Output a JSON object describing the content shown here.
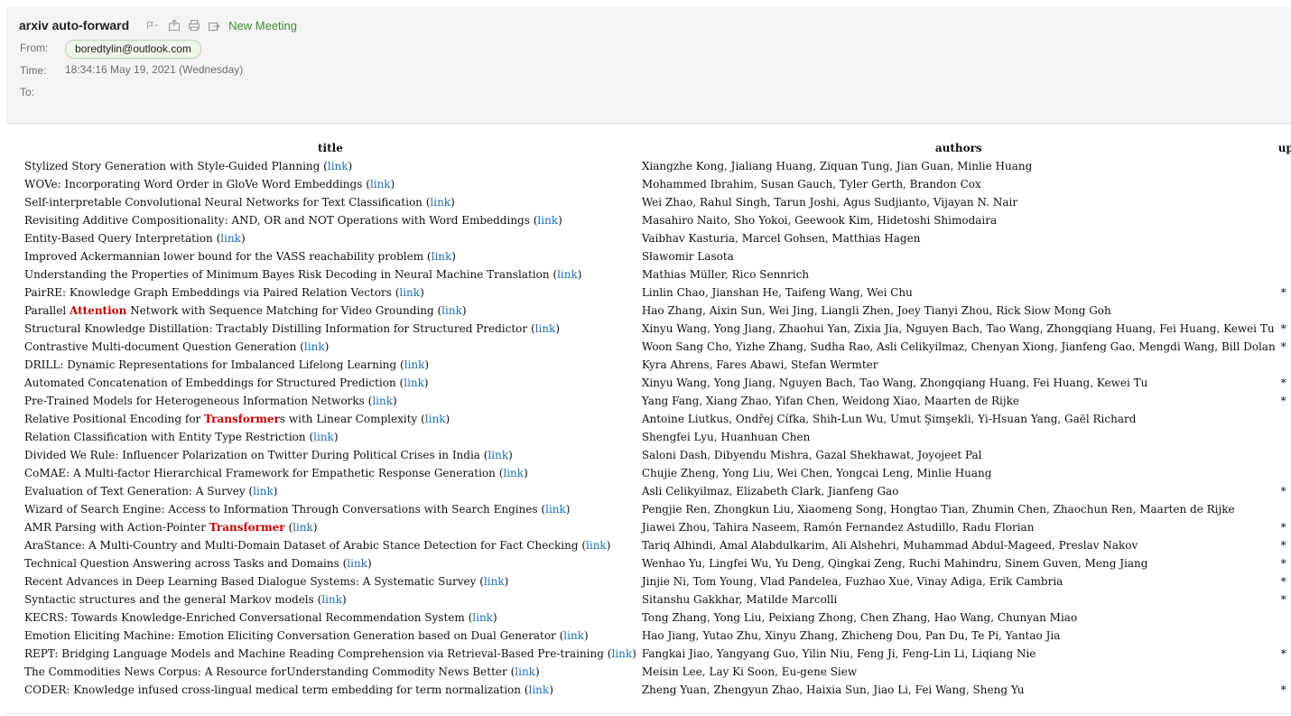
{
  "email": {
    "subject": "arxiv auto-forward",
    "toolbar": {
      "new_meeting_label": "New Meeting"
    },
    "from_label": "From:",
    "from_value": "boredtylin@outlook.com",
    "time_label": "Time:",
    "time_value": "18:34:16 May 19, 2021 (Wednesday)",
    "to_label": "To:"
  },
  "table": {
    "headers": {
      "title": "title",
      "authors": "authors",
      "update": "update"
    },
    "link_text": "link",
    "rows": [
      {
        "parts": [
          {
            "t": "Stylized Story Generation with Style-Guided Planning "
          }
        ],
        "authors": "Xiangzhe Kong, Jialiang Huang, Ziquan Tung, Jian Guan, Minlie Huang",
        "update": ""
      },
      {
        "parts": [
          {
            "t": "WOVe: Incorporating Word Order in GloVe Word Embeddings "
          }
        ],
        "authors": "Mohammed Ibrahim, Susan Gauch, Tyler Gerth, Brandon Cox",
        "update": ""
      },
      {
        "parts": [
          {
            "t": "Self-interpretable Convolutional Neural Networks for Text Classification "
          }
        ],
        "authors": "Wei Zhao, Rahul Singh, Tarun Joshi, Agus Sudjianto, Vijayan N. Nair",
        "update": ""
      },
      {
        "parts": [
          {
            "t": "Revisiting Additive Compositionality: AND, OR and NOT Operations with Word Embeddings "
          }
        ],
        "authors": "Masahiro Naito, Sho Yokoi, Geewook Kim, Hidetoshi Shimodaira",
        "update": ""
      },
      {
        "parts": [
          {
            "t": "Entity-Based Query Interpretation "
          }
        ],
        "authors": "Vaibhav Kasturia, Marcel Gohsen, Matthias Hagen",
        "update": ""
      },
      {
        "parts": [
          {
            "t": "Improved Ackermannian lower bound for the VASS reachability problem "
          }
        ],
        "authors": "Sławomir Lasota",
        "update": ""
      },
      {
        "parts": [
          {
            "t": "Understanding the Properties of Minimum Bayes Risk Decoding in Neural Machine Translation "
          }
        ],
        "authors": "Mathias Müller, Rico Sennrich",
        "update": ""
      },
      {
        "parts": [
          {
            "t": "PairRE: Knowledge Graph Embeddings via Paired Relation Vectors "
          }
        ],
        "authors": "Linlin Chao, Jianshan He, Taifeng Wang, Wei Chu",
        "update": "*"
      },
      {
        "parts": [
          {
            "t": "Parallel "
          },
          {
            "t": "Attention",
            "h": true
          },
          {
            "t": " Network with Sequence Matching for Video Grounding "
          }
        ],
        "authors": "Hao Zhang, Aixin Sun, Wei Jing, Liangli Zhen, Joey Tianyi Zhou, Rick Siow Mong Goh",
        "update": ""
      },
      {
        "parts": [
          {
            "t": "Structural Knowledge Distillation: Tractably Distilling Information for Structured Predictor "
          }
        ],
        "authors": "Xinyu Wang, Yong Jiang, Zhaohui Yan, Zixia Jia, Nguyen Bach, Tao Wang, Zhongqiang Huang, Fei Huang, Kewei Tu",
        "update": "*"
      },
      {
        "parts": [
          {
            "t": "Contrastive Multi-document Question Generation "
          }
        ],
        "authors": "Woon Sang Cho, Yizhe Zhang, Sudha Rao, Asli Celikyilmaz, Chenyan Xiong, Jianfeng Gao, Mengdi Wang, Bill Dolan",
        "update": "*"
      },
      {
        "parts": [
          {
            "t": "DRILL: Dynamic Representations for Imbalanced Lifelong Learning "
          }
        ],
        "authors": "Kyra Ahrens, Fares Abawi, Stefan Wermter",
        "update": ""
      },
      {
        "parts": [
          {
            "t": "Automated Concatenation of Embeddings for Structured Prediction "
          }
        ],
        "authors": "Xinyu Wang, Yong Jiang, Nguyen Bach, Tao Wang, Zhongqiang Huang, Fei Huang, Kewei Tu",
        "update": "*"
      },
      {
        "parts": [
          {
            "t": "Pre-Trained Models for Heterogeneous Information Networks "
          }
        ],
        "authors": "Yang Fang, Xiang Zhao, Yifan Chen, Weidong Xiao, Maarten de Rijke",
        "update": "*"
      },
      {
        "parts": [
          {
            "t": "Relative Positional Encoding for "
          },
          {
            "t": "Transformer",
            "h": true
          },
          {
            "t": "s with Linear Complexity "
          }
        ],
        "authors": "Antoine Liutkus, Ondřej Cífka, Shih-Lun Wu, Umut Şimşekli, Yi-Hsuan Yang, Gaël Richard",
        "update": ""
      },
      {
        "parts": [
          {
            "t": "Relation Classification with Entity Type Restriction "
          }
        ],
        "authors": "Shengfei Lyu, Huanhuan Chen",
        "update": ""
      },
      {
        "parts": [
          {
            "t": "Divided We Rule: Influencer Polarization on Twitter During Political Crises in India "
          }
        ],
        "authors": "Saloni Dash, Dibyendu Mishra, Gazal Shekhawat, Joyojeet Pal",
        "update": ""
      },
      {
        "parts": [
          {
            "t": "CoMAE: A Multi-factor Hierarchical Framework for Empathetic Response Generation "
          }
        ],
        "authors": "Chujie Zheng, Yong Liu, Wei Chen, Yongcai Leng, Minlie Huang",
        "update": ""
      },
      {
        "parts": [
          {
            "t": "Evaluation of Text Generation: A Survey "
          }
        ],
        "authors": "Asli Celikyilmaz, Elizabeth Clark, Jianfeng Gao",
        "update": "*"
      },
      {
        "parts": [
          {
            "t": "Wizard of Search Engine: Access to Information Through Conversations with Search Engines "
          }
        ],
        "authors": "Pengjie Ren, Zhongkun Liu, Xiaomeng Song, Hongtao Tian, Zhumin Chen, Zhaochun Ren, Maarten de Rijke",
        "update": ""
      },
      {
        "parts": [
          {
            "t": "AMR Parsing with Action-Pointer "
          },
          {
            "t": "Transformer",
            "h": true
          },
          {
            "t": " "
          }
        ],
        "authors": "Jiawei Zhou, Tahira Naseem, Ramón Fernandez Astudillo, Radu Florian",
        "update": "*"
      },
      {
        "parts": [
          {
            "t": "AraStance: A Multi-Country and Multi-Domain Dataset of Arabic Stance Detection for Fact Checking "
          }
        ],
        "authors": "Tariq Alhindi, Amal Alabdulkarim, Ali Alshehri, Muhammad Abdul-Mageed, Preslav Nakov",
        "update": "*"
      },
      {
        "parts": [
          {
            "t": "Technical Question Answering across Tasks and Domains "
          }
        ],
        "authors": "Wenhao Yu, Lingfei Wu, Yu Deng, Qingkai Zeng, Ruchi Mahindru, Sinem Guven, Meng Jiang",
        "update": "*"
      },
      {
        "parts": [
          {
            "t": "Recent Advances in Deep Learning Based Dialogue Systems: A Systematic Survey "
          }
        ],
        "authors": "Jinjie Ni, Tom Young, Vlad Pandelea, Fuzhao Xue, Vinay Adiga, Erik Cambria",
        "update": "*"
      },
      {
        "parts": [
          {
            "t": "Syntactic structures and the general Markov models "
          }
        ],
        "authors": "Sitanshu Gakkhar, Matilde Marcolli",
        "update": "*"
      },
      {
        "parts": [
          {
            "t": "KECRS: Towards Knowledge-Enriched Conversational Recommendation System "
          }
        ],
        "authors": "Tong Zhang, Yong Liu, Peixiang Zhong, Chen Zhang, Hao Wang, Chunyan Miao",
        "update": ""
      },
      {
        "parts": [
          {
            "t": "Emotion Eliciting Machine: Emotion Eliciting Conversation Generation based on Dual Generator "
          }
        ],
        "authors": "Hao Jiang, Yutao Zhu, Xinyu Zhang, Zhicheng Dou, Pan Du, Te Pi, Yantao Jia",
        "update": ""
      },
      {
        "parts": [
          {
            "t": "REPT: Bridging Language Models and Machine Reading Comprehension via Retrieval-Based Pre-training "
          }
        ],
        "authors": "Fangkai Jiao, Yangyang Guo, Yilin Niu, Feng Ji, Feng-Lin Li, Liqiang Nie",
        "update": "*"
      },
      {
        "parts": [
          {
            "t": "The Commodities News Corpus: A Resource forUnderstanding Commodity News Better "
          }
        ],
        "authors": "Meisin Lee, Lay Ki Soon, Eu-gene Siew",
        "update": ""
      },
      {
        "parts": [
          {
            "t": "CODER: Knowledge infused cross-lingual medical term embedding for term normalization "
          }
        ],
        "authors": "Zheng Yuan, Zhengyun Zhao, Haixia Sun, Jiao Li, Fei Wang, Sheng Yu",
        "update": "*"
      }
    ]
  },
  "colors": {
    "link": "#1a6fb5",
    "highlight": "#c00000",
    "new_meeting": "#3d8b2f",
    "header_bg": "#f4f4f4"
  },
  "icons": [
    "flag-icon",
    "move-icon",
    "print-icon",
    "forward-icon"
  ]
}
